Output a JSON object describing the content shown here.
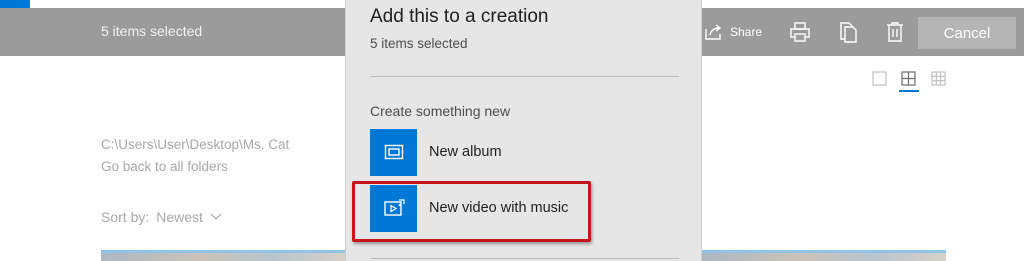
{
  "selection_bar": {
    "count_text": "5 items selected",
    "share_label": "Share",
    "cancel_label": "Cancel"
  },
  "view_options": [
    "single-view-icon",
    "grid-medium-icon",
    "grid-small-icon"
  ],
  "folder": {
    "path": "C:\\Users\\User\\Desktop\\Ms. Cat",
    "back_link": "Go back to all folders"
  },
  "sort": {
    "label": "Sort by:",
    "value": "Newest"
  },
  "panel": {
    "title": "Add this to a creation",
    "subtitle": "5 items selected",
    "section_label": "Create something new",
    "options": [
      {
        "label": "New album",
        "icon": "album-icon"
      },
      {
        "label": "New video with music",
        "icon": "video-music-icon"
      }
    ]
  },
  "colors": {
    "accent": "#0078d7",
    "selection_bar": "#9b9b9b",
    "panel_bg": "#e6e6e6",
    "highlight": "#c4161c"
  }
}
